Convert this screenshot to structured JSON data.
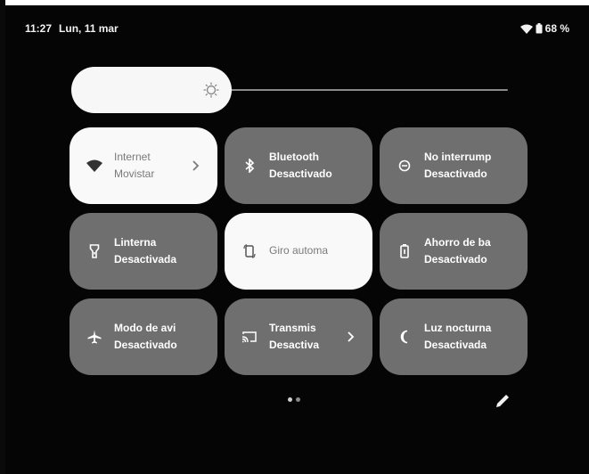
{
  "status_bar": {
    "time": "11:27",
    "date": "Lun, 11 mar",
    "battery": "68 %",
    "icons": [
      "wifi-icon",
      "battery-icon"
    ]
  },
  "brightness": {
    "icon": "brightness-icon",
    "level": 0.26
  },
  "tiles": [
    {
      "id": "internet",
      "icon": "wifi-icon",
      "title": "Internet",
      "subtitle": "Movistar",
      "active": true,
      "chevron": true
    },
    {
      "id": "bluetooth",
      "icon": "bluetooth-icon",
      "title": "Bluetooth",
      "subtitle": "Desactivado",
      "active": false,
      "chevron": false
    },
    {
      "id": "dnd",
      "icon": "do-not-disturb-icon",
      "title": "No interrump",
      "subtitle": "Desactivado",
      "active": false,
      "chevron": false
    },
    {
      "id": "flashlight",
      "icon": "flashlight-icon",
      "title": "Linterna",
      "subtitle": "Desactivada",
      "active": false,
      "chevron": false
    },
    {
      "id": "autorotate",
      "icon": "rotate-icon",
      "title": "Giro automa",
      "subtitle": "",
      "active": true,
      "chevron": false
    },
    {
      "id": "battery-saver",
      "icon": "battery-saver-icon",
      "title": "Ahorro de ba",
      "subtitle": "Desactivado",
      "active": false,
      "chevron": false
    },
    {
      "id": "airplane",
      "icon": "airplane-icon",
      "title": "Modo de avi",
      "subtitle": "Desactivado",
      "active": false,
      "chevron": false
    },
    {
      "id": "cast",
      "icon": "cast-icon",
      "title": "Transmis",
      "subtitle": "Desactiva",
      "active": false,
      "chevron": true
    },
    {
      "id": "night-light",
      "icon": "night-light-icon",
      "title": "Luz nocturna",
      "subtitle": "Desactivada",
      "active": false,
      "chevron": false
    }
  ],
  "pager": {
    "pages": 2,
    "current": 1
  },
  "edit": {
    "icon": "edit-pencil-icon"
  }
}
